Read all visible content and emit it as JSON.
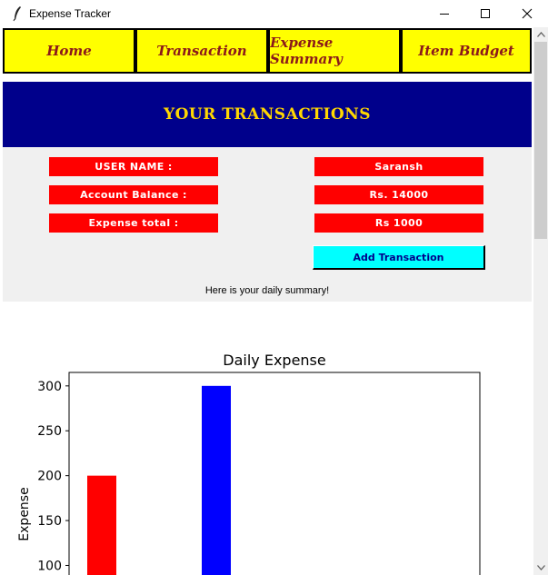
{
  "window": {
    "title": "Expense Tracker"
  },
  "nav": {
    "items": [
      {
        "label": "Home"
      },
      {
        "label": "Transaction"
      },
      {
        "label": "Expense Summary"
      },
      {
        "label": "Item Budget"
      }
    ],
    "background_color": "#ffff00",
    "text_color": "#8b1a1a"
  },
  "banner": {
    "title": "YOUR TRANSACTIONS",
    "background_color": "#00008b",
    "text_color": "#ffd700"
  },
  "info": {
    "labels": [
      "USER NAME :",
      "Account Balance :",
      "Expense total :"
    ],
    "values": [
      "Saransh",
      "Rs. 14000",
      "Rs 1000"
    ],
    "pill_color": "#ff0000",
    "add_button_label": "Add Transaction",
    "add_button_color": "#00ffff",
    "summary_text": "Here is your daily summary!"
  },
  "chart_data": {
    "type": "bar",
    "title": "Daily Expense",
    "ylabel": "Expense",
    "xlabel": "",
    "values": [
      200,
      300
    ],
    "colors": [
      "#ff0000",
      "#0000ff"
    ],
    "yticks": [
      100,
      150,
      200,
      250,
      300
    ],
    "ylim": [
      60,
      315
    ]
  }
}
